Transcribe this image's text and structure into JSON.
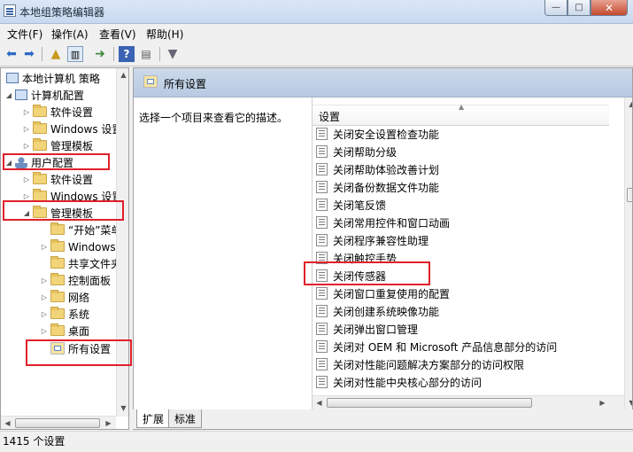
{
  "window": {
    "title": "本地组策略编辑器",
    "buttons": {
      "minimize": "—",
      "maximize": "□",
      "close": "✕"
    }
  },
  "menu": [
    "文件(F)",
    "操作(A)",
    "查看(V)",
    "帮助(H)"
  ],
  "toolbar": {
    "icons": [
      "back-icon",
      "forward-icon",
      "up-folder-icon",
      "show-tree-icon",
      "export-icon",
      "help-icon",
      "properties-icon",
      "filter-icon"
    ]
  },
  "tree": {
    "root": "本地计算机 策略",
    "computer_config": "计算机配置",
    "computer_children": [
      "软件设置",
      "Windows 设置",
      "管理模板"
    ],
    "user_config": "用户配置",
    "user_children": [
      "软件设置",
      "Windows 设置",
      "管理模板"
    ],
    "admin_children": [
      "“开始”菜单",
      "Windows 组",
      "共享文件夹",
      "控制面板",
      "网络",
      "系统",
      "桌面",
      "所有设置"
    ]
  },
  "right_header": {
    "title": "所有设置"
  },
  "description": "选择一个项目来查看它的描述。",
  "list": {
    "column": "设置",
    "items": [
      "关闭安全设置检查功能",
      "关闭帮助分级",
      "关闭帮助体验改善计划",
      "关闭备份数据文件功能",
      "关闭笔反馈",
      "关闭常用控件和窗口动画",
      "关闭程序兼容性助理",
      "关闭触控手势",
      "关闭传感器",
      "关闭窗口重复使用的配置",
      "关闭创建系统映像功能",
      "关闭弹出窗口管理",
      "关闭对 OEM 和 Microsoft 产品信息部分的访问",
      "关闭对性能问题解决方案部分的访问权限",
      "关闭对性能中央核心部分的访问"
    ]
  },
  "tabs": [
    "扩展",
    "标准"
  ],
  "status": "1415 个设置",
  "highlight_color": "#e0202a"
}
